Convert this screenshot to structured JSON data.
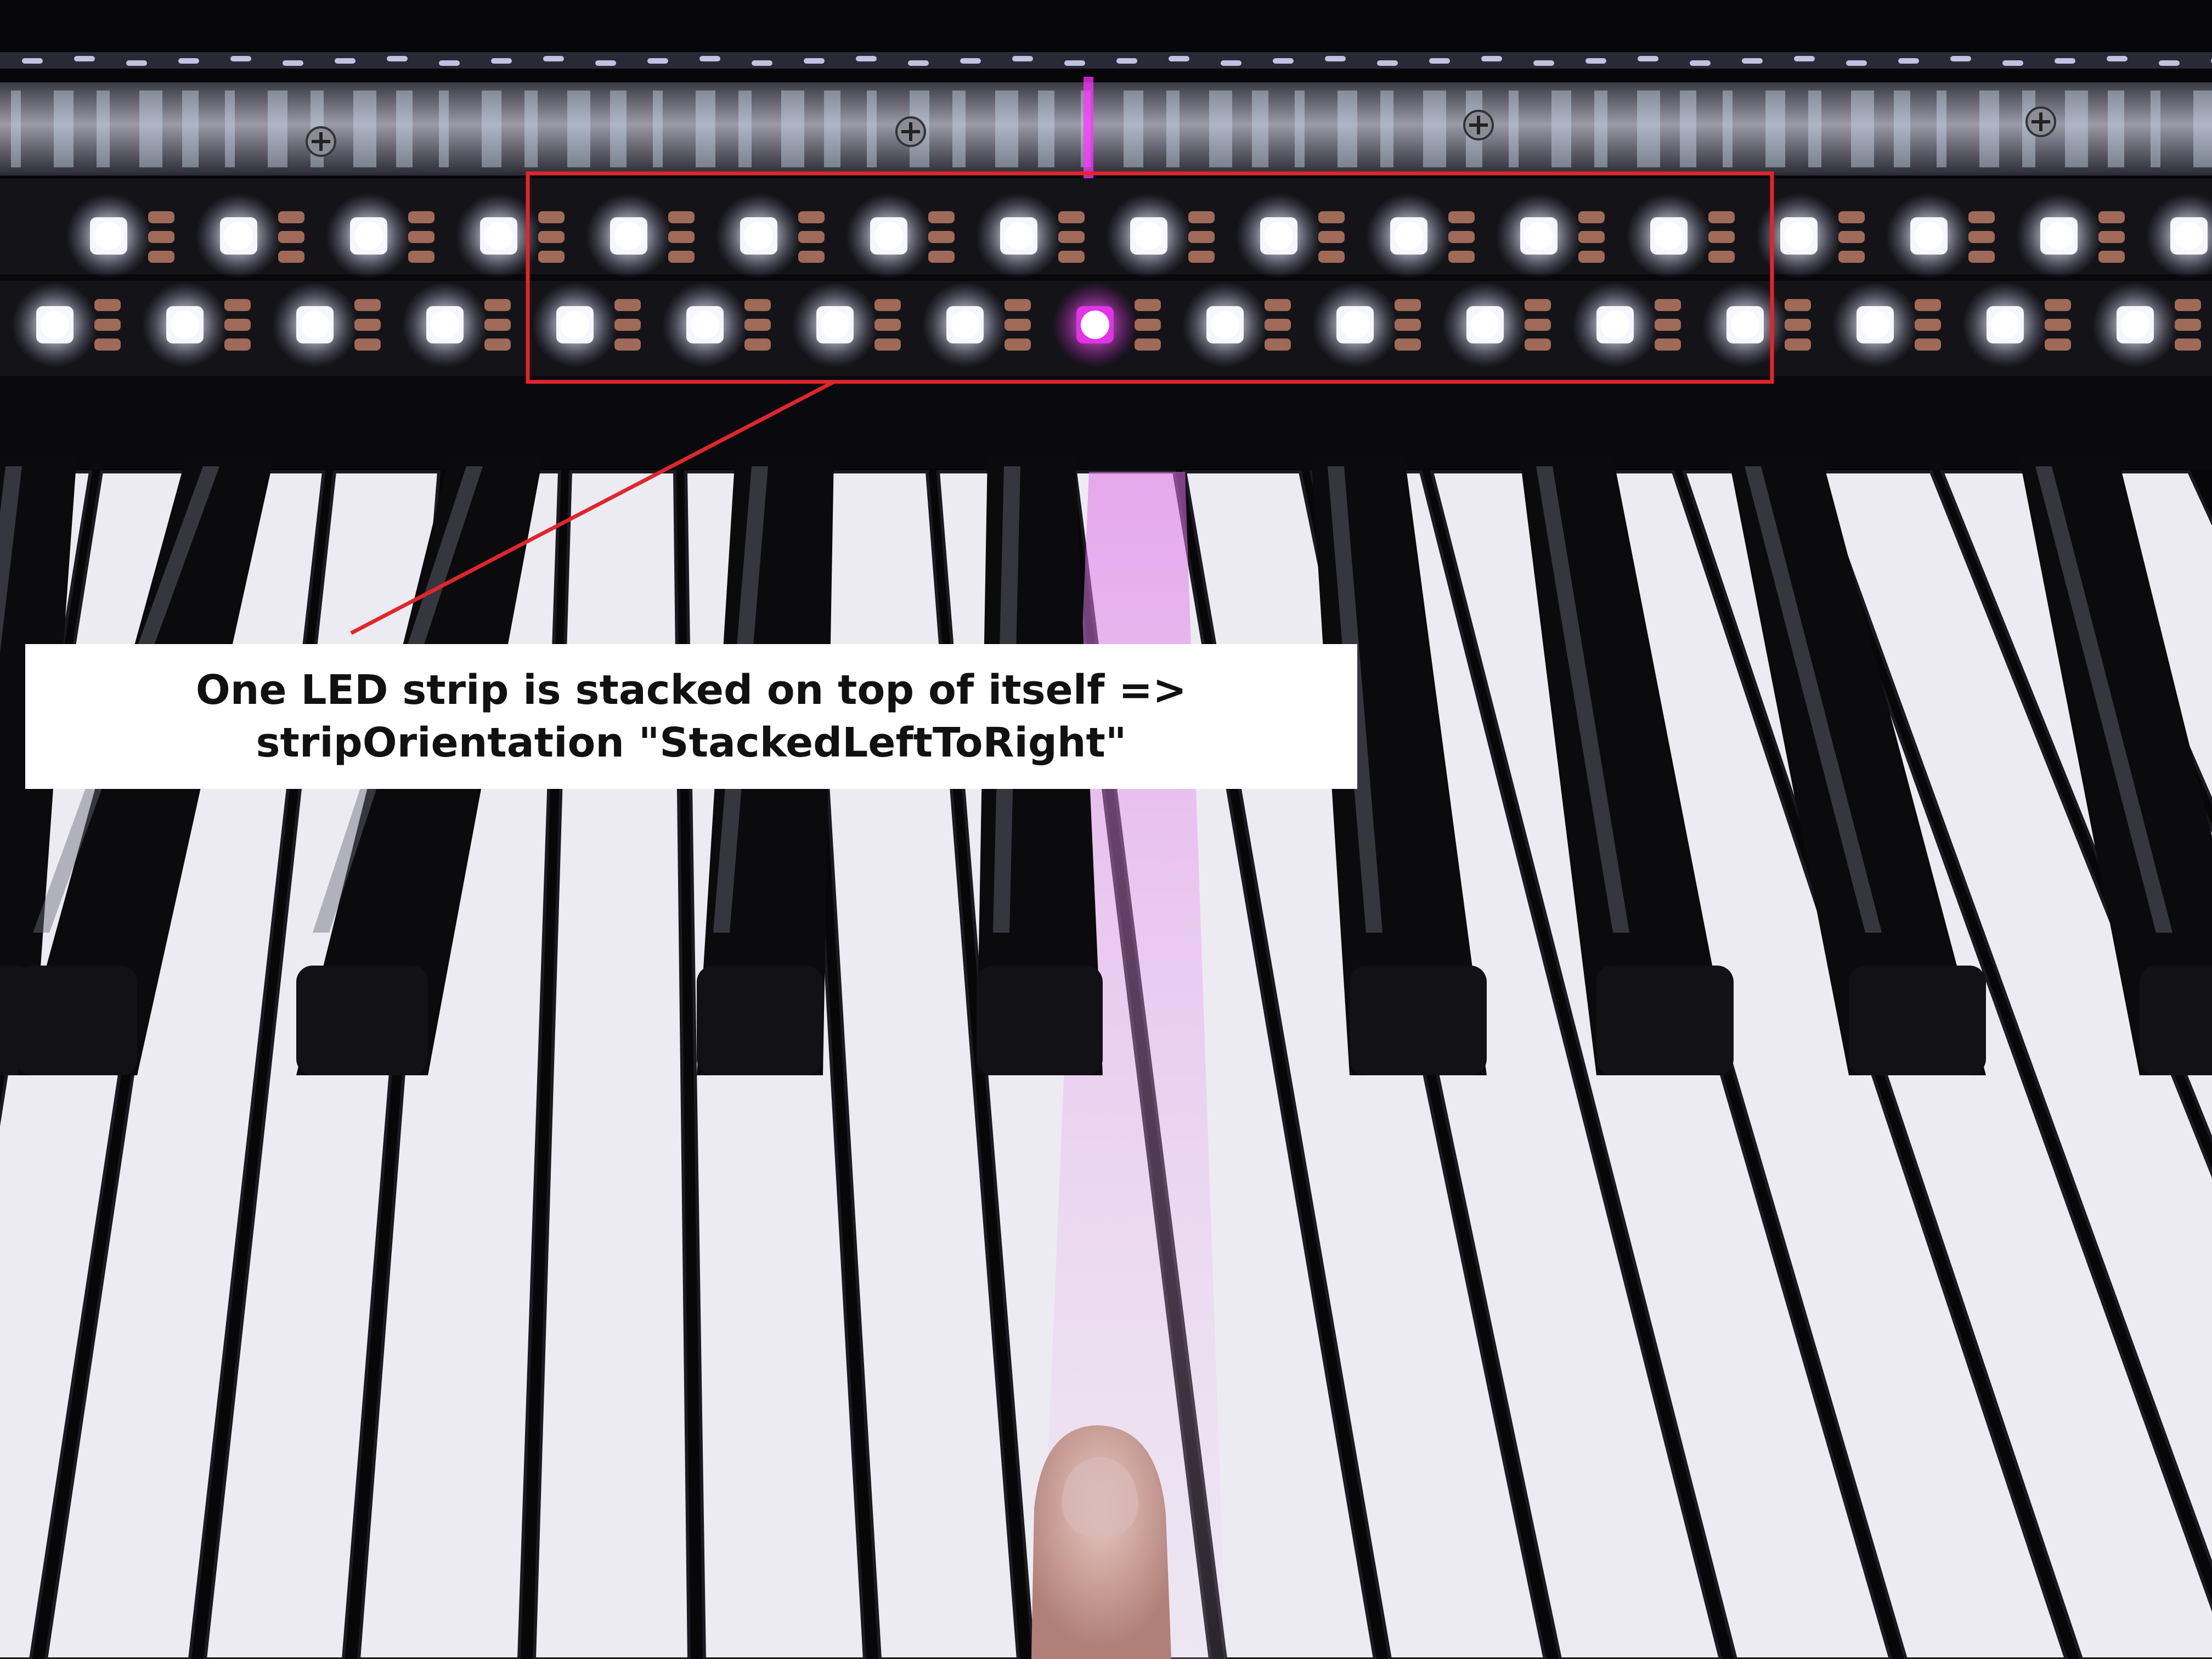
{
  "annotation": {
    "line1": "One LED strip is stacked on top of itself =>",
    "line2": "stripOrientation \"StackedLeftToRight\""
  },
  "colors": {
    "highlight_box": "#e0262b",
    "lit_led_white": "#f6f6ff",
    "lit_led_magenta": "#e233e8",
    "strip_pcb": "#141418",
    "white_key": "#ecebf2",
    "black_key": "#0b0b0d"
  },
  "leds": {
    "top_row_lit_count": 17,
    "bottom_row_lit_count": 17,
    "magenta_led_row": "bottom",
    "magenta_led_index": 8
  },
  "icons": [
    "screw-icon"
  ]
}
